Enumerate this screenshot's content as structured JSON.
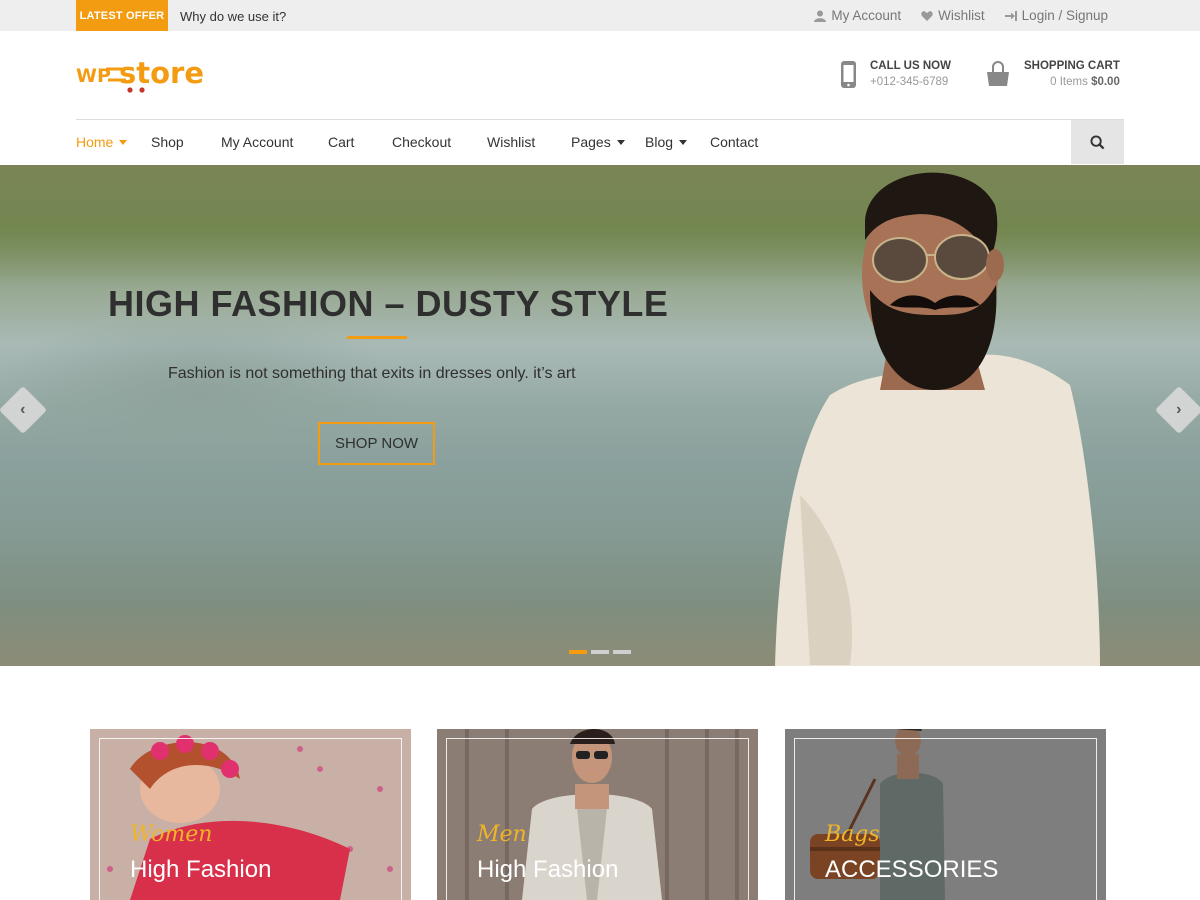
{
  "topbar": {
    "offer_badge": "LATEST OFFER",
    "offer_text": "Why do we use it?",
    "links": [
      {
        "label": "My Account",
        "icon": "user-icon"
      },
      {
        "label": "Wishlist",
        "icon": "heart-icon"
      },
      {
        "label": "Login / Signup",
        "icon": "login-icon"
      }
    ]
  },
  "header": {
    "logo_wp": "WP",
    "logo_store": "store",
    "call_title": "CALL US NOW",
    "call_number": "+012-345-6789",
    "cart_title": "SHOPPING CART",
    "cart_items": "0 Items",
    "cart_total": "$0.00"
  },
  "nav": {
    "items": [
      {
        "label": "Home",
        "dropdown": true,
        "active": true
      },
      {
        "label": "Shop",
        "dropdown": false
      },
      {
        "label": "My Account",
        "dropdown": false
      },
      {
        "label": "Cart",
        "dropdown": false
      },
      {
        "label": "Checkout",
        "dropdown": false
      },
      {
        "label": "Wishlist",
        "dropdown": false
      },
      {
        "label": "Pages",
        "dropdown": true
      },
      {
        "label": "Blog",
        "dropdown": true
      },
      {
        "label": "Contact",
        "dropdown": false
      }
    ]
  },
  "hero": {
    "title": "HIGH FASHION – DUSTY STYLE",
    "subtitle": "Fashion is not something that exits in  dresses only. it’s art",
    "button": "SHOP NOW",
    "prev_arrow": "‹",
    "next_arrow": "›",
    "active_slide": 1,
    "slide_count": 3
  },
  "categories": [
    {
      "script": "Women",
      "title": "High Fashion"
    },
    {
      "script": "Men",
      "title": "High Fashion"
    },
    {
      "script": "Bags",
      "title": "ACCESSORIES"
    }
  ],
  "colors": {
    "accent": "#f39c12",
    "topbar_bg": "#eeeeee",
    "search_bg": "#e5e5e5"
  }
}
